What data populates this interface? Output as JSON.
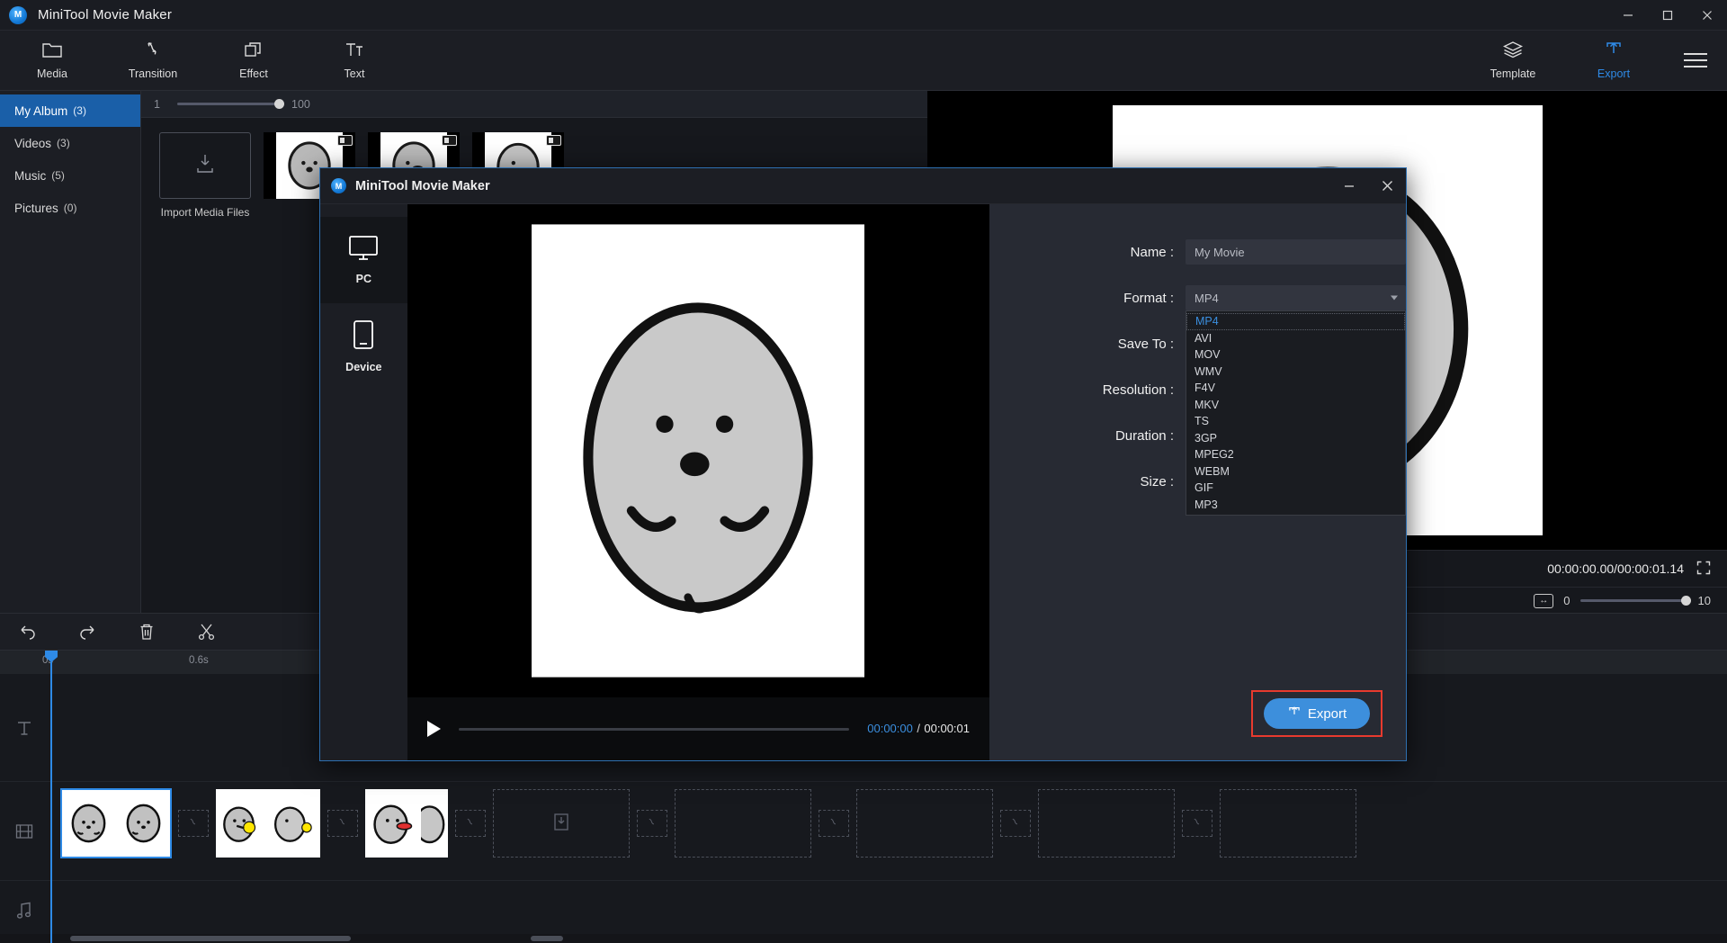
{
  "window": {
    "title": "MiniTool Movie Maker",
    "logo_text": "M",
    "minimize": "—",
    "maximize": "▢",
    "close": "✕"
  },
  "ribbon": {
    "items": [
      {
        "label": "Media",
        "icon": "folder-icon",
        "active": false
      },
      {
        "label": "Transition",
        "icon": "transition-icon",
        "active": false
      },
      {
        "label": "Effect",
        "icon": "effect-icon",
        "active": false
      },
      {
        "label": "Text",
        "icon": "text-icon",
        "active": false
      }
    ],
    "right_items": [
      {
        "label": "Template",
        "icon": "layers-icon",
        "active": false
      },
      {
        "label": "Export",
        "icon": "upload-icon",
        "active": true
      }
    ],
    "menu_icon": "hamburger-menu-icon"
  },
  "library": {
    "items": [
      {
        "label": "My Album",
        "count": "(3)",
        "active": true
      },
      {
        "label": "Videos",
        "count": "(3)",
        "active": false
      },
      {
        "label": "Music",
        "count": "(5)",
        "active": false
      },
      {
        "label": "Pictures",
        "count": "(0)",
        "active": false
      }
    ]
  },
  "media_panel": {
    "slider_min": "1",
    "slider_max": "100",
    "import_label": "Import Media Files",
    "import_icon": "import-download-icon"
  },
  "player": {
    "timecode": "00:00:00.00/00:00:01.14",
    "fullscreen_icon": "fullscreen-icon",
    "zoom_min": "0",
    "zoom_max": "10",
    "fit_icon": "fit-to-screen-icon"
  },
  "edit_toolbar": {
    "buttons": [
      {
        "name": "undo-button",
        "icon": "undo-icon"
      },
      {
        "name": "redo-button",
        "icon": "redo-icon"
      },
      {
        "name": "delete-button",
        "icon": "trash-icon"
      },
      {
        "name": "split-button",
        "icon": "scissors-icon"
      }
    ]
  },
  "timeline": {
    "ruler_ticks": [
      "0s",
      "0.6s"
    ],
    "text_track_icon": "text-track-icon",
    "video_track_icon": "video-track-icon",
    "music_track_icon": "music-note-icon",
    "transition_slot_icon": "transition-slot-icon",
    "add_media_slot_icon": "add-media-icon"
  },
  "dialog": {
    "title": "MiniTool Movie Maker",
    "logo_text": "M",
    "minimize": "—",
    "close": "✕",
    "destinations": [
      {
        "label": "PC",
        "icon": "monitor-icon",
        "active": true
      },
      {
        "label": "Device",
        "icon": "phone-icon",
        "active": false
      }
    ],
    "preview": {
      "play_icon": "play-icon",
      "current_time": "00:00:00",
      "separator": "/",
      "total_time": "00:00:01"
    },
    "fields": [
      {
        "label": "Name :",
        "value": "My Movie",
        "type": "input"
      },
      {
        "label": "Format :",
        "value": "MP4",
        "type": "select"
      },
      {
        "label": "Save To :",
        "value": "",
        "type": "input"
      },
      {
        "label": "Resolution :",
        "value": "",
        "type": "input"
      },
      {
        "label": "Duration :",
        "value": "",
        "type": "text"
      },
      {
        "label": "Size :",
        "value": "",
        "type": "text"
      }
    ],
    "format_options": [
      "MP4",
      "AVI",
      "MOV",
      "WMV",
      "F4V",
      "MKV",
      "TS",
      "3GP",
      "MPEG2",
      "WEBM",
      "GIF",
      "MP3"
    ],
    "format_selected": "MP4",
    "export_button": {
      "label": "Export",
      "icon": "upload-icon"
    }
  },
  "colors": {
    "accent_blue": "#2e8ae6",
    "active_blue": "#1a5fa8",
    "highlight_red": "#e83a2e",
    "button_blue": "#3d8fdc",
    "panel_bg": "#272a33",
    "app_bg": "#1c1e24"
  }
}
